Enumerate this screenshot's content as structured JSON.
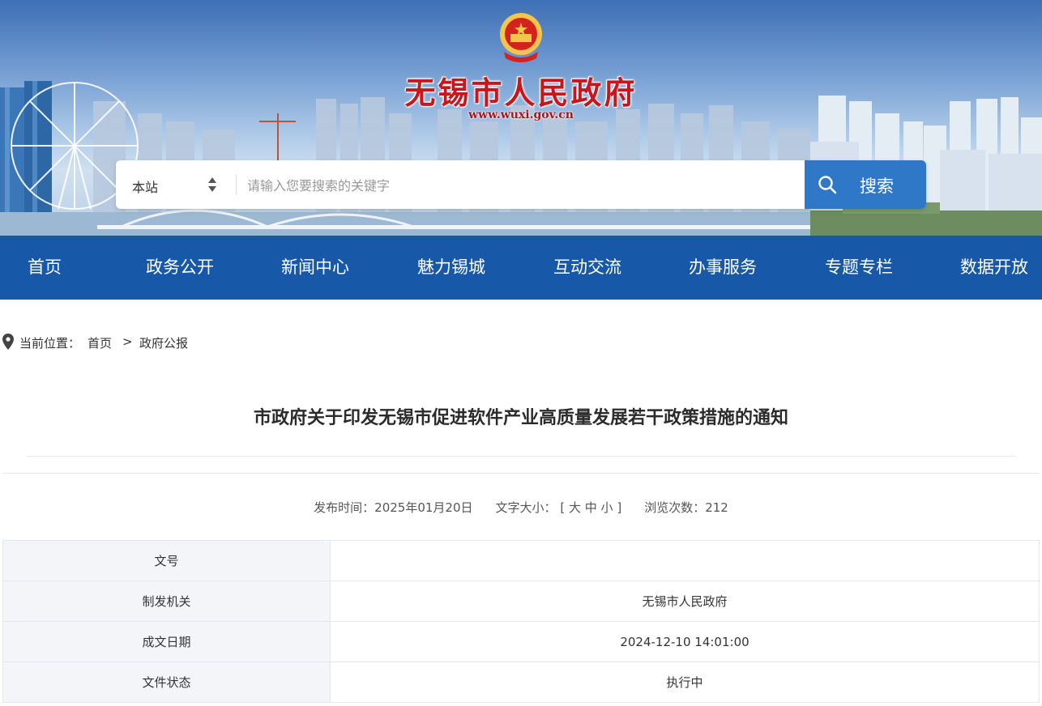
{
  "header": {
    "site_title": "无锡市人民政府",
    "site_url": "www.wuxi.gov.cn",
    "emblem_icon": "national-emblem-icon",
    "search": {
      "scope_label": "本站",
      "placeholder": "请输入您要搜索的关键字",
      "value": "",
      "button_label": "搜索",
      "button_icon": "search-icon"
    }
  },
  "nav": {
    "items": [
      {
        "label": "首页"
      },
      {
        "label": "政务公开"
      },
      {
        "label": "新闻中心"
      },
      {
        "label": "魅力锡城"
      },
      {
        "label": "互动交流"
      },
      {
        "label": "办事服务"
      },
      {
        "label": "专题专栏"
      },
      {
        "label": "数据开放"
      }
    ]
  },
  "breadcrumb": {
    "prefix": "当前位置：",
    "items": [
      "首页",
      "政府公报"
    ],
    "separator": ">"
  },
  "article": {
    "title": "市政府关于印发无锡市促进软件产业高质量发展若干政策措施的通知",
    "meta": {
      "publish_label": "发布时间：",
      "publish_date": "2025年01月20日",
      "font_size_label": "文字大小：",
      "bracket_open": "[",
      "size_large": "大",
      "size_medium": "中",
      "size_small": "小",
      "bracket_close": "]",
      "views_label": "浏览次数：",
      "views": "212"
    },
    "info_table": [
      {
        "key": "文号",
        "value": ""
      },
      {
        "key": "制发机关",
        "value": "无锡市人民政府"
      },
      {
        "key": "成文日期",
        "value": "2024-12-10 14:01:00"
      },
      {
        "key": "文件状态",
        "value": "执行中"
      }
    ]
  },
  "colors": {
    "nav_bg": "#1858a8",
    "search_button": "#2f78c8",
    "title_red": "#c8161d",
    "table_key_bg": "#f3f5f8"
  }
}
